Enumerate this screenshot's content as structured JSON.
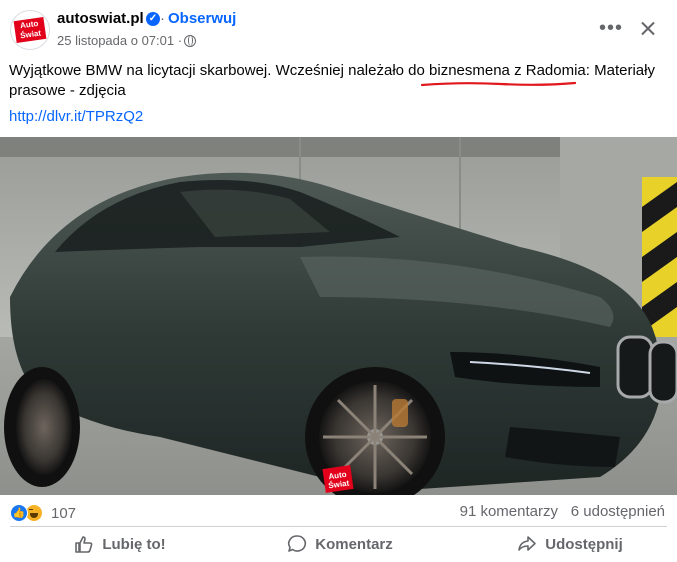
{
  "post": {
    "page_name": "autoswiat.pl",
    "avatar_logo_line1": "Auto",
    "avatar_logo_line2": "Świat",
    "separator": "·",
    "follow_label": "Obserwuj",
    "timestamp": "25 listopada o 07:01 ·",
    "text_before": "Wyjątkowe BMW na licytacji skarbowej. Wcześniej należało do ",
    "text_highlight": "biznesmena z Radomia",
    "text_after": ": Materiały prasowe - zdjęcia",
    "link": "http://dlvr.it/TPRzQ2",
    "photo_watermark_line1": "Auto",
    "photo_watermark_line2": "Świat"
  },
  "stats": {
    "reaction_count": "107",
    "comments": "91 komentarzy",
    "shares": "6 udostępnień"
  },
  "actions": {
    "like": "Lubię to!",
    "comment": "Komentarz",
    "share": "Udostępnij"
  },
  "icons": {
    "verified": "verified-badge-icon",
    "globe": "globe-icon",
    "more": "more-icon",
    "close": "close-icon",
    "like": "thumbs-up-icon",
    "comment": "comment-bubble-icon",
    "share": "share-arrow-icon"
  },
  "colors": {
    "accent": "#0866ff",
    "secondary_text": "#65676b",
    "annotation_underline": "#e0171c"
  }
}
